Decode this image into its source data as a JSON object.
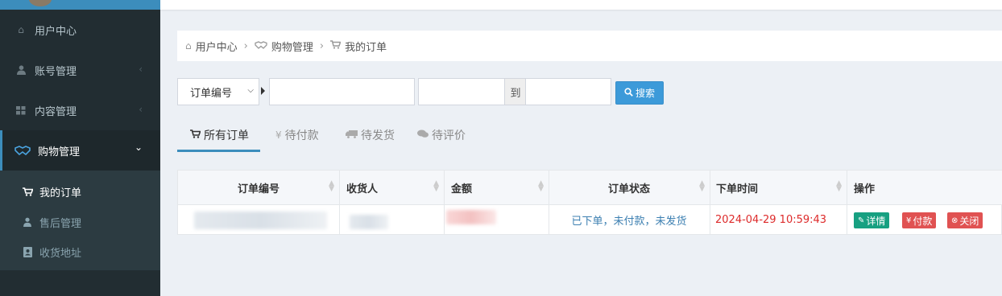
{
  "sidebar": {
    "items": [
      {
        "label": "用户中心",
        "icon": "home-icon"
      },
      {
        "label": "账号管理",
        "icon": "user-icon"
      },
      {
        "label": "内容管理",
        "icon": "grid-icon"
      },
      {
        "label": "购物管理",
        "icon": "handshake-icon"
      }
    ],
    "sub_items": [
      {
        "label": "我的订单",
        "icon": "cart-icon"
      },
      {
        "label": "售后管理",
        "icon": "user-group-icon"
      },
      {
        "label": "收货地址",
        "icon": "address-book-icon"
      }
    ]
  },
  "breadcrumb": [
    "用户中心",
    "购物管理",
    "我的订单"
  ],
  "search": {
    "field_select": "订单编号",
    "keyword_value": "",
    "date_from": "",
    "to_label": "到",
    "date_to": "",
    "button_label": "搜索"
  },
  "tabs": [
    {
      "label": "所有订单",
      "icon": "cart-icon"
    },
    {
      "label": "待付款",
      "icon": "yen-icon"
    },
    {
      "label": "待发货",
      "icon": "truck-icon"
    },
    {
      "label": "待评价",
      "icon": "comments-icon"
    }
  ],
  "table": {
    "headers": [
      "订单编号",
      "收货人",
      "金额",
      "订单状态",
      "下单时间",
      "操作"
    ],
    "rows": [
      {
        "status": "已下单，未付款，未发货",
        "time": "2024-04-29 10:59:43",
        "actions": [
          "详情",
          "付款",
          "关闭"
        ]
      }
    ]
  },
  "colors": {
    "sidebar_bg": "#222d32",
    "accent": "#3c8dbc",
    "status": "#3c7fb1",
    "time": "#dd2a2a",
    "detail_btn": "#17a081",
    "danger_btn": "#e05252"
  }
}
